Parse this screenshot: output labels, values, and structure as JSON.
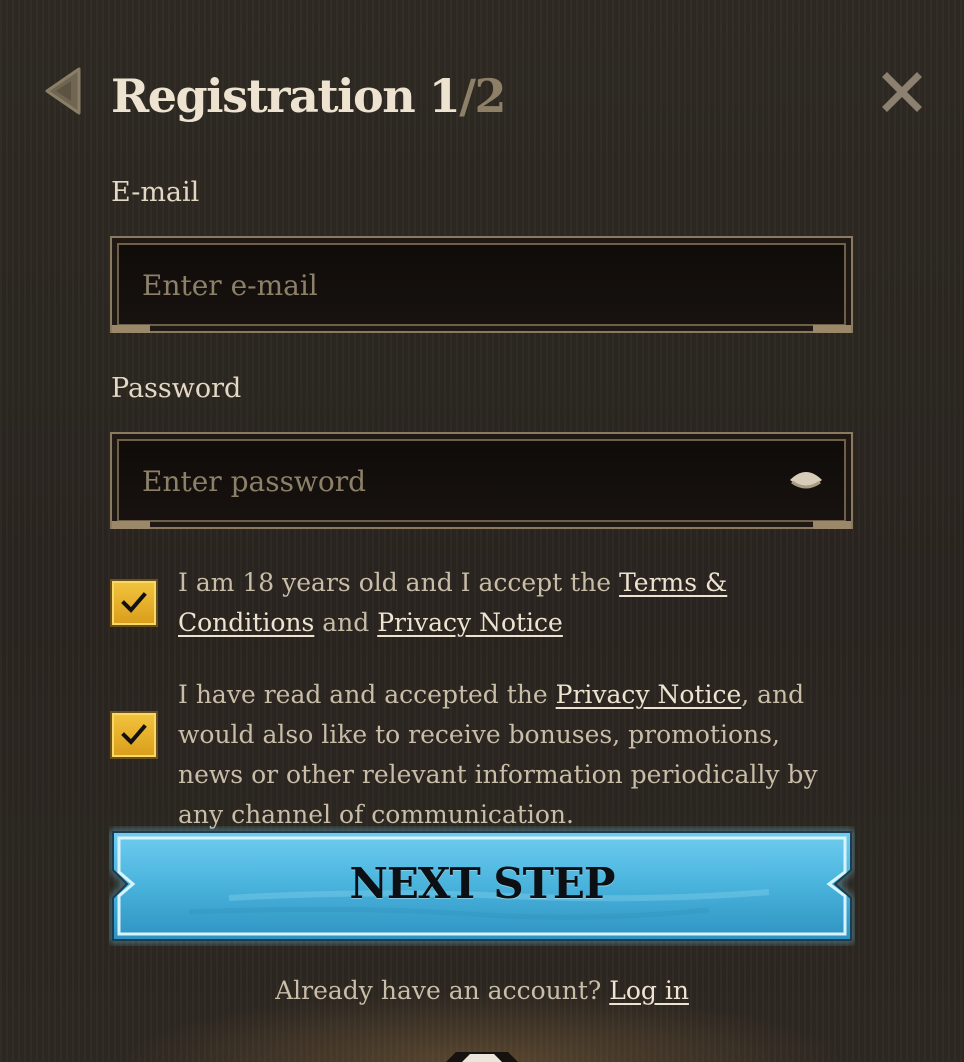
{
  "header": {
    "title": "Registration",
    "step_current": "1",
    "step_total": "/2",
    "back_icon": "triangle-left-icon",
    "close_icon": "close-icon"
  },
  "email": {
    "label": "E-mail",
    "placeholder": "Enter e-mail",
    "value": ""
  },
  "password": {
    "label": "Password",
    "placeholder": "Enter password",
    "value": "",
    "toggle_icon": "eye-icon"
  },
  "consents": [
    {
      "checked": true,
      "text_before": "I am 18 years old and I accept the ",
      "link1": "Terms & Conditions",
      "text_middle": " and ",
      "link2": "Privacy Notice",
      "text_after": ""
    },
    {
      "checked": true,
      "text_before": "I have read and accepted the ",
      "link1": "Privacy Notice",
      "text_after": ", and would also like to receive bonuses, promotions, news or other relevant information periodically by any channel of communication."
    }
  ],
  "next_button": {
    "label": "NEXT STEP"
  },
  "footer": {
    "text": "Already have an account? ",
    "link": "Log in"
  },
  "colors": {
    "background": "#2b2620",
    "accent_blue": "#4cb6dc",
    "checkbox_gold": "#e8b22a",
    "text_primary": "#ede3d0",
    "text_muted": "#8e8067"
  }
}
